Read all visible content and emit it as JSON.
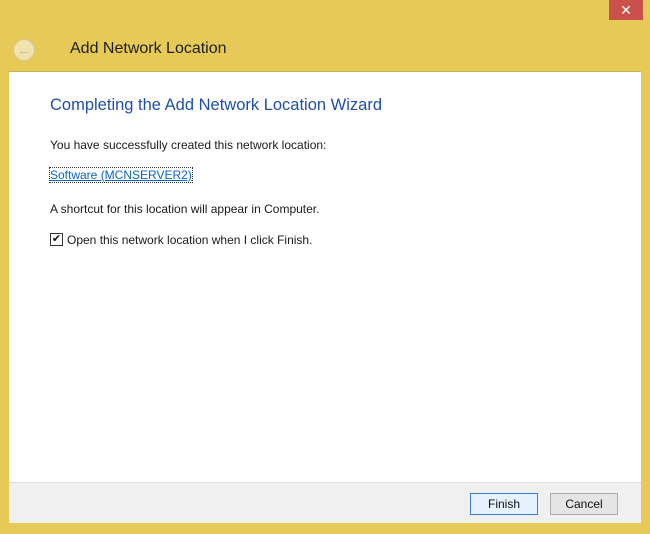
{
  "window": {
    "title": "Add Network Location",
    "close_glyph": "✕",
    "back_glyph": "←"
  },
  "content": {
    "heading": "Completing the Add Network Location Wizard",
    "success_text": "You have successfully created this network location:",
    "location_link": "Software (MCNSERVER2)",
    "shortcut_text": "A shortcut for this location will appear in Computer.",
    "open_checkbox": {
      "label": "Open this network location when I click Finish.",
      "checked": true,
      "glyph": "✔"
    }
  },
  "footer": {
    "finish": "Finish",
    "cancel": "Cancel"
  },
  "colors": {
    "frame": "#e6c957",
    "close": "#c9504b",
    "heading": "#1f4fa8",
    "link": "#0a66c2"
  }
}
